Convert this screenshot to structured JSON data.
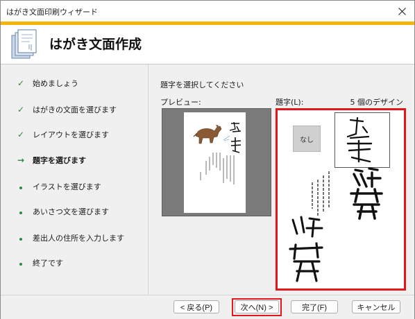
{
  "window": {
    "title": "はがき文面印刷ウィザード"
  },
  "header": {
    "title": "はがき文面作成"
  },
  "steps": [
    {
      "label": "始めましょう",
      "state": "done"
    },
    {
      "label": "はがきの文面を選びます",
      "state": "done"
    },
    {
      "label": "レイアウトを選びます",
      "state": "done"
    },
    {
      "label": "題字を選びます",
      "state": "current"
    },
    {
      "label": "イラストを選びます",
      "state": "pending"
    },
    {
      "label": "あいさつ文を選びます",
      "state": "pending"
    },
    {
      "label": "差出人の住所を入力します",
      "state": "pending"
    },
    {
      "label": "終了です",
      "state": "pending"
    }
  ],
  "main": {
    "instruction": "題字を選択してください",
    "preview_label": "プレビュー:",
    "design_label": "題字(L):",
    "design_count": "5 個のデザイン",
    "designs": [
      {
        "label": "なし"
      },
      {
        "text": "謹賀",
        "selected": true
      },
      {
        "text": "頌春"
      },
      {
        "text": "あけましておめでとうございます"
      },
      {
        "text": "頌春"
      }
    ]
  },
  "footer": {
    "back": "< 戻る(P)",
    "next": "次へ(N) >",
    "finish": "完了(F)",
    "cancel": "キャンセル"
  },
  "colors": {
    "accent": "#f5b40a",
    "highlight": "#e3161c",
    "check": "#2a8a3e"
  }
}
